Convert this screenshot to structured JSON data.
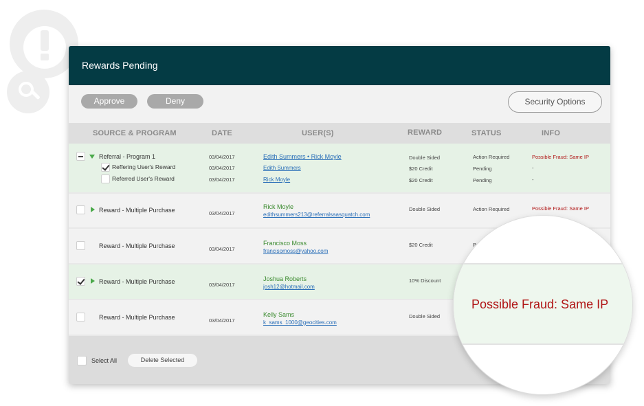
{
  "panel": {
    "title": "Rewards Pending"
  },
  "toolbar": {
    "approve_label": "Approve",
    "deny_label": "Deny",
    "security_label": "Security Options"
  },
  "columns": {
    "source": "SOURCE & PROGRAM",
    "date": "DATE",
    "users": "USER(S)",
    "reward": "REWARD",
    "status": "STATUS",
    "info": "INFO"
  },
  "rows": [
    {
      "program": "Referral - Program 1",
      "date": "03/04/2017",
      "users": "Edith Summers • Rick Moyle",
      "reward": "Double Sided",
      "status": "Action Required",
      "info": "Possible Fraud: Same IP",
      "sub_rows": [
        {
          "label": "Reffering User's Reward",
          "date": "03/04/2017",
          "user": "Edith Summers",
          "reward": "$20 Credit",
          "status": "Pending",
          "info": "-"
        },
        {
          "label": "Referred User's Reward",
          "date": "03/04/2017",
          "user": "Rick Moyle",
          "reward": "$20 Credit",
          "status": "Pending",
          "info": "-"
        }
      ]
    },
    {
      "program": "Reward - Multiple Purchase",
      "date": "03/04/2017",
      "name": "Rick Moyle",
      "email": "edithsummers213@referralsaasquatch.com",
      "reward": "Double Sided",
      "status": "Action Required",
      "info": "Possible Fraud: Same IP"
    },
    {
      "program": "Reward - Multiple Purchase",
      "date": "03/04/2017",
      "name": "Francisco Moss",
      "email": "francisomoss@yahoo.com",
      "reward": "$20 Credit",
      "status": "P"
    },
    {
      "program": "Reward - Multiple Purchase",
      "date": "03/04/2017",
      "name": "Joshua Roberts",
      "email": "josh12@hotmail.com",
      "reward": "10% Discount"
    },
    {
      "program": "Reward - Multiple Purchase",
      "date": "03/04/2017",
      "name": "Kelly Sams",
      "email": "k_sams_1000@geocities.com",
      "reward": "Double Sided"
    }
  ],
  "footer": {
    "select_all_label": "Select All",
    "delete_label": "Delete Selected"
  },
  "magnifier": {
    "text": "Possible Fraud: Same IP"
  },
  "colors": {
    "header_bg": "#043b44",
    "highlight_row": "#e6f2e6",
    "fraud_red": "#b01515",
    "user_green": "#3a8a2e",
    "link_blue": "#2a6fb8"
  },
  "icons": [
    "alert-icon",
    "search-icon",
    "expand-arrow-icon",
    "collapse-arrow-icon",
    "checkbox-icon"
  ]
}
